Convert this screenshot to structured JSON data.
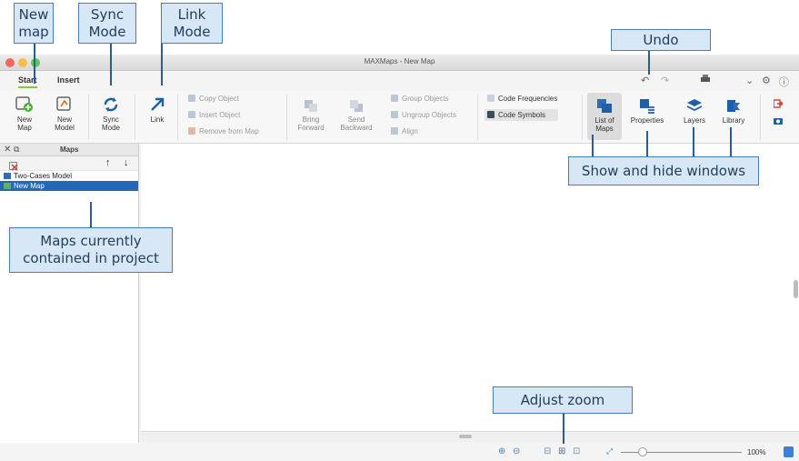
{
  "window": {
    "title": "MAXMaps - New Map",
    "traffic_colors": [
      "#ee6a5f",
      "#f5bd4f",
      "#61c554"
    ]
  },
  "tabs": [
    {
      "label": "Start",
      "active": true
    },
    {
      "label": "Insert",
      "active": false
    }
  ],
  "ribbon": {
    "new_map": {
      "line1": "New",
      "line2": "Map"
    },
    "new_model": {
      "line1": "New",
      "line2": "Model"
    },
    "sync_mode": {
      "line1": "Sync",
      "line2": "Mode"
    },
    "link": "Link",
    "copy_object": "Copy Object",
    "insert_object": "Insert Object",
    "remove_from_map": "Remove from Map",
    "bring_forward": {
      "line1": "Bring",
      "line2": "Forward"
    },
    "send_backward": {
      "line1": "Send",
      "line2": "Backward"
    },
    "group_objects": "Group Objects",
    "ungroup_objects": "Ungroup Objects",
    "align": "Align",
    "code_frequencies": "Code Frequencies",
    "code_symbols": "Code Symbols",
    "list_of_maps": {
      "line1": "List of",
      "line2": "Maps"
    },
    "properties": "Properties",
    "layers": "Layers",
    "library": "Library"
  },
  "maps_panel": {
    "title": "Maps",
    "items": [
      {
        "label": "Two-Cases Model",
        "selected": false
      },
      {
        "label": "New Map",
        "selected": true
      }
    ]
  },
  "statusbar": {
    "zoom": "100%"
  },
  "callouts": {
    "new_map": "New\nmap",
    "sync_mode": "Sync\nMode",
    "link_mode": "Link\nMode",
    "undo": "Undo",
    "show_hide": "Show and hide windows",
    "maps_contained": "Maps currently\ncontained in project",
    "adjust_zoom": "Adjust zoom"
  },
  "colors": {
    "callout_fill": "#d8e7f5",
    "callout_border": "#4a7fb5",
    "accent_tab": "#8cc63f",
    "selection": "#2466b8",
    "icon_blue": "#1f5fa8"
  },
  "icons": [
    "new-map-icon",
    "new-model-icon",
    "sync-icon",
    "link-arrow-icon",
    "undo-icon",
    "redo-icon",
    "printer-icon",
    "gear-icon",
    "help-icon",
    "close-icon",
    "detach-icon",
    "sort-up-icon",
    "sort-down-icon",
    "zoom-in-icon",
    "zoom-out-icon",
    "fit-width-icon",
    "fit-page-icon",
    "zoom-slider-icon"
  ]
}
